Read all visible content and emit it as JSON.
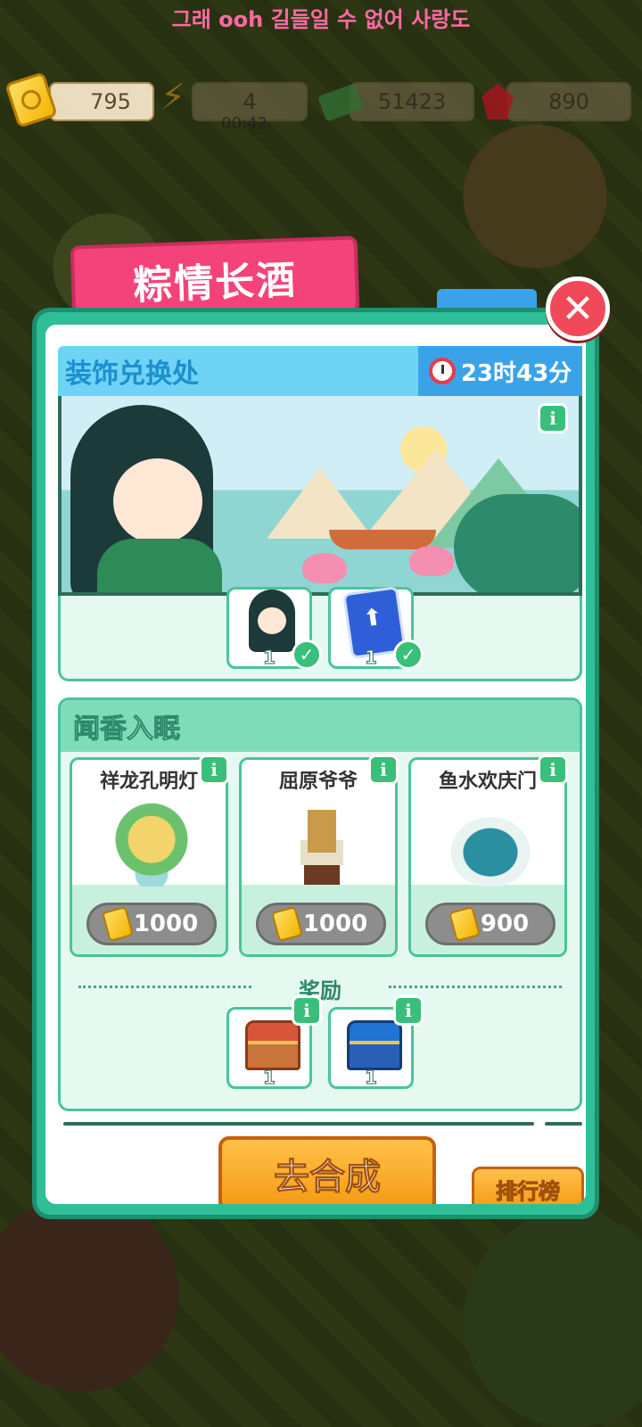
{
  "status": {
    "lyric": "그래 ooh 길들일 수 없어 사랑도"
  },
  "resources": {
    "tickets": "795",
    "energy": "4",
    "energy_timer": "00:42",
    "cash": "51423",
    "gems": "890"
  },
  "event": {
    "title": "粽情长酒"
  },
  "shop": {
    "header": "装饰兑换处",
    "timer": "23时43分"
  },
  "previous_rewards": [
    {
      "count": "1",
      "icon": "character-figure-icon",
      "claimed": true
    },
    {
      "count": "1",
      "icon": "upgrade-card-icon",
      "claimed": true
    }
  ],
  "section": {
    "title": "闻香入眠",
    "items": [
      {
        "name": "祥龙孔明灯",
        "price": "1000",
        "icon": "dragon-lantern-icon"
      },
      {
        "name": "屈原爷爷",
        "price": "1000",
        "icon": "quyuan-statue-icon"
      },
      {
        "name": "鱼水欢庆门",
        "price": "900",
        "icon": "fish-gate-icon"
      }
    ],
    "reward_label": "奖励",
    "rewards": [
      {
        "count": "1",
        "icon": "red-chest-icon"
      },
      {
        "count": "1",
        "icon": "blue-chest-icon"
      }
    ]
  },
  "buttons": {
    "go": "去合成",
    "ranking": "排行榜",
    "close": "✕",
    "info": "i"
  },
  "colors": {
    "panel": "#2fbf98",
    "ribbon": "#f4437a",
    "header": "#6fd3f5",
    "accent_orange": "#f59a14"
  }
}
